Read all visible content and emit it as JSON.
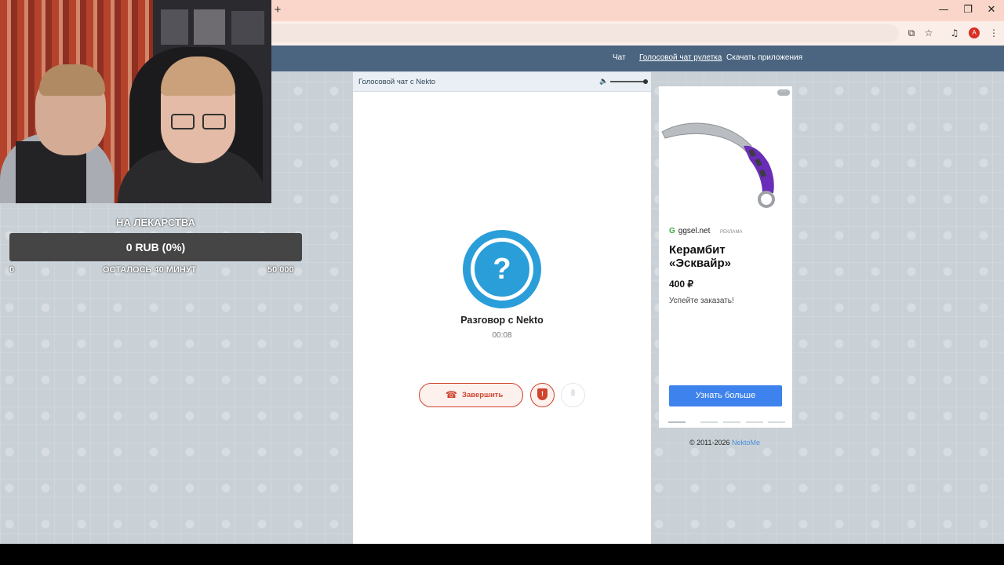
{
  "browser": {
    "new_tab": "+",
    "window_controls": {
      "minimize": "—",
      "restore": "❐",
      "close": "✕"
    },
    "tools": [
      "install-icon",
      "bookmark-star-icon",
      "media-icon",
      "profile-avatar",
      "menu-dots-icon"
    ],
    "profile_initial": "A"
  },
  "site": {
    "nav": [
      "Чат",
      "Голосовой чат рулетка",
      "Скачать приложения"
    ],
    "chat": {
      "header": "Голосовой чат с Nekto",
      "volume_level": 1.0,
      "call_title": "Разговор с Nekto",
      "timer": "00:08",
      "end_button": "Завершить"
    },
    "ad": {
      "site": "ggsel.net",
      "tag": "РЕКЛАМА",
      "title": "Керамбит «Эсквайр»",
      "price": "400 ₽",
      "subtitle": "Успейте заказать!",
      "button": "Узнать больше"
    },
    "copyright_prefix": "© 2011-2026 ",
    "copyright_link": "NektoMe"
  },
  "stream_overlay": {
    "goal_title": "НА ЛЕКАРСТВА",
    "goal_amount": "0 RUB (0%)",
    "goal_min": "0",
    "goal_remaining": "ОСТАЛОСЬ 40 МИНУТ",
    "goal_max": "50 000"
  },
  "colors": {
    "nav": "#4b6580",
    "accent_blue": "#2a9ed8",
    "danger": "#d0442f",
    "ad_button": "#3d82ed"
  }
}
